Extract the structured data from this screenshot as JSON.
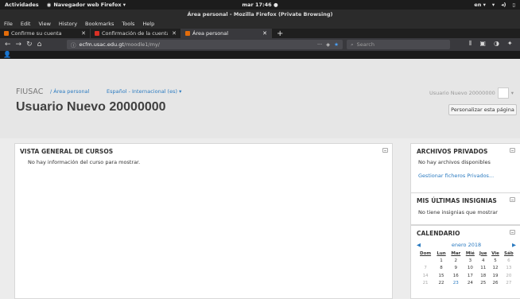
{
  "system": {
    "activities": "Actividades",
    "app_menu": "Navegador web Firefox ▾",
    "clock": "mar 17:46 ●",
    "lang": "en ▾"
  },
  "window": {
    "title": "Área personal - Mozilla Firefox (Private Browsing)"
  },
  "menu": [
    "File",
    "Edit",
    "View",
    "History",
    "Bookmarks",
    "Tools",
    "Help"
  ],
  "tabs": [
    {
      "label": "Confirme su cuenta",
      "active": false
    },
    {
      "label": "Confirmación de la cuenta",
      "active": false
    },
    {
      "label": "Área personal",
      "active": true
    }
  ],
  "nav": {
    "url_domain": "ecfm.usac.edu.gt",
    "url_path": "/moodle1/my/",
    "search_placeholder": "Search",
    "url_more": "···"
  },
  "moodle": {
    "site_name": "FIUSAC",
    "breadcrumb": "/ Área personal",
    "language": "Español - Internacional (es) ▾",
    "user_menu": "Usuario Nuevo 20000000",
    "page_title": "Usuario Nuevo 20000000",
    "customize_button": "Personalizar esta página"
  },
  "course_overview": {
    "title": "VISTA GENERAL DE CURSOS",
    "empty_text": "No hay información del curso para mostrar."
  },
  "private_files": {
    "title": "ARCHIVOS PRIVADOS",
    "empty_text": "No hay archivos disponibles",
    "manage_link": "Gestionar ficheros Privados..."
  },
  "badges": {
    "title": "MIS ÚLTIMAS INSIGNIAS",
    "empty_text": "No tiene insignias que mostrar"
  },
  "calendar": {
    "title": "CALENDARIO",
    "month": "enero 2018",
    "weekdays": [
      "Dom",
      "Lun",
      "Mar",
      "Mié",
      "Jue",
      "Vie",
      "Sáb"
    ],
    "weeks": [
      [
        "",
        "1",
        "2",
        "3",
        "4",
        "5",
        "6"
      ],
      [
        "7",
        "8",
        "9",
        "10",
        "11",
        "12",
        "13"
      ],
      [
        "14",
        "15",
        "16",
        "17",
        "18",
        "19",
        "20"
      ],
      [
        "21",
        "22",
        "23",
        "24",
        "25",
        "26",
        "27"
      ]
    ],
    "today": "23"
  },
  "colors": {
    "link": "#2a7ac0",
    "header_bg": "#e6e6e6",
    "moodle_bar": "#1b1b1b"
  }
}
